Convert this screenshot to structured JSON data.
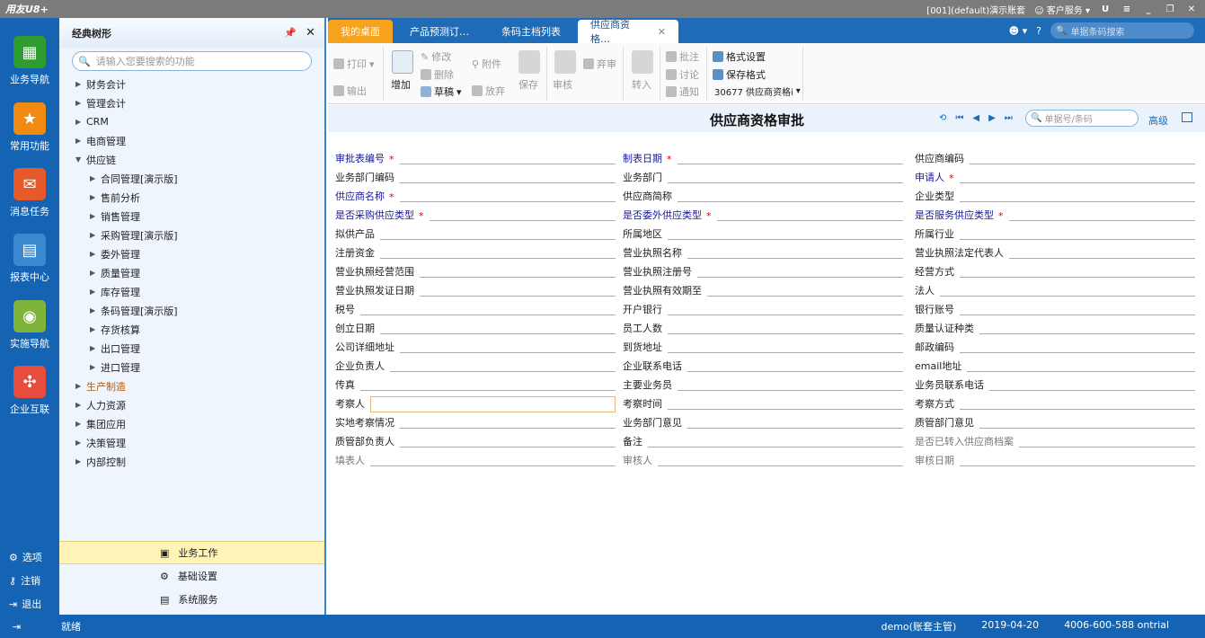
{
  "app": {
    "logo": "用友U8+",
    "account": "[001](default)演示账套",
    "customer_service": "客户服务"
  },
  "leftnav": {
    "items": [
      {
        "label": "业务导航",
        "color": "#2e9c2e"
      },
      {
        "label": "常用功能",
        "color": "#f08a10"
      },
      {
        "label": "消息任务",
        "color": "#e65a2a"
      },
      {
        "label": "报表中心",
        "color": "#3a88cf"
      },
      {
        "label": "实施导航",
        "color": "#7fb43a"
      },
      {
        "label": "企业互联",
        "color": "#e84c3d"
      }
    ],
    "bottom": [
      "选项",
      "注销",
      "退出"
    ]
  },
  "tree": {
    "title": "经典树形",
    "search_placeholder": "请输入您要搜索的功能",
    "items": [
      {
        "label": "财务会计",
        "level": 1,
        "arrow": "▶"
      },
      {
        "label": "管理会计",
        "level": 1,
        "arrow": "▶"
      },
      {
        "label": "CRM",
        "level": 1,
        "arrow": "▶"
      },
      {
        "label": "电商管理",
        "level": 1,
        "arrow": "▶"
      },
      {
        "label": "供应链",
        "level": 1,
        "arrow": "▼"
      },
      {
        "label": "合同管理[演示版]",
        "level": 2,
        "arrow": "▶"
      },
      {
        "label": "售前分析",
        "level": 2,
        "arrow": "▶"
      },
      {
        "label": "销售管理",
        "level": 2,
        "arrow": "▶"
      },
      {
        "label": "采购管理[演示版]",
        "level": 2,
        "arrow": "▶"
      },
      {
        "label": "委外管理",
        "level": 2,
        "arrow": "▶"
      },
      {
        "label": "质量管理",
        "level": 2,
        "arrow": "▶"
      },
      {
        "label": "库存管理",
        "level": 2,
        "arrow": "▶"
      },
      {
        "label": "条码管理[演示版]",
        "level": 2,
        "arrow": "▶"
      },
      {
        "label": "存货核算",
        "level": 2,
        "arrow": "▶"
      },
      {
        "label": "出口管理",
        "level": 2,
        "arrow": "▶"
      },
      {
        "label": "进口管理",
        "level": 2,
        "arrow": "▶"
      },
      {
        "label": "生产制造",
        "level": 1,
        "arrow": "▶",
        "selected": true
      },
      {
        "label": "人力资源",
        "level": 1,
        "arrow": "▶"
      },
      {
        "label": "集团应用",
        "level": 1,
        "arrow": "▶"
      },
      {
        "label": "决策管理",
        "level": 1,
        "arrow": "▶"
      },
      {
        "label": "内部控制",
        "level": 1,
        "arrow": "▶"
      }
    ],
    "bottom": [
      "业务工作",
      "基础设置",
      "系统服务"
    ]
  },
  "tabs": [
    "我的桌面",
    "产品预测订…",
    "条码主档列表",
    "供应商资格…"
  ],
  "header_search_placeholder": "单据条码搜索",
  "toolbar": {
    "print": "打印",
    "output": "输出",
    "add": "增加",
    "modify": "修改",
    "delete": "删除",
    "draft": "草稿",
    "attach": "附件",
    "abandon": "放弃",
    "save": "保存",
    "review": "审核",
    "discard": "弃审",
    "transfer": "转入",
    "annotate": "批注",
    "discuss": "讨论",
    "notify": "通知",
    "format_settings": "格式设置",
    "save_format": "保存格式",
    "template": "30677 供应商资格i"
  },
  "form": {
    "title": "供应商资格审批",
    "search_placeholder": "单据号/条码",
    "advanced": "高级",
    "rows": [
      [
        {
          "label": "审批表编号",
          "req": true
        },
        {
          "label": "制表日期",
          "req": true
        },
        {
          "label": "供应商编码"
        }
      ],
      [
        {
          "label": "业务部门编码"
        },
        {
          "label": "业务部门"
        },
        {
          "label": "申请人",
          "req": true
        }
      ],
      [
        {
          "label": "供应商名称",
          "req": true
        },
        {
          "label": "供应商简称"
        },
        {
          "label": "企业类型"
        }
      ],
      [
        {
          "label": "是否采购供应类型",
          "req": true
        },
        {
          "label": "是否委外供应类型",
          "req": true
        },
        {
          "label": "是否服务供应类型",
          "req": true
        }
      ],
      [
        {
          "label": "拟供产品"
        },
        {
          "label": "所属地区"
        },
        {
          "label": "所属行业"
        }
      ],
      [
        {
          "label": "注册资金"
        },
        {
          "label": "营业执照名称"
        },
        {
          "label": "营业执照法定代表人"
        }
      ],
      [
        {
          "label": "营业执照经营范围"
        },
        {
          "label": "营业执照注册号"
        },
        {
          "label": "经营方式"
        }
      ],
      [
        {
          "label": "营业执照发证日期"
        },
        {
          "label": "营业执照有效期至"
        },
        {
          "label": "法人"
        }
      ],
      [
        {
          "label": "税号"
        },
        {
          "label": "开户银行"
        },
        {
          "label": "银行账号"
        }
      ],
      [
        {
          "label": "创立日期"
        },
        {
          "label": "员工人数"
        },
        {
          "label": "质量认证种类"
        }
      ],
      [
        {
          "label": "公司详细地址"
        },
        {
          "label": "到货地址"
        },
        {
          "label": "邮政编码"
        }
      ],
      [
        {
          "label": "企业负责人"
        },
        {
          "label": "企业联系电话"
        },
        {
          "label": "email地址"
        }
      ],
      [
        {
          "label": "传真"
        },
        {
          "label": "主要业务员"
        },
        {
          "label": "业务员联系电话"
        }
      ],
      [
        {
          "label": "考察人",
          "focused": true
        },
        {
          "label": "考察时间"
        },
        {
          "label": "考察方式"
        }
      ],
      [
        {
          "label": "实地考察情况"
        },
        {
          "label": "业务部门意见"
        },
        {
          "label": "质管部门意见"
        }
      ],
      [
        {
          "label": "质管部负责人"
        },
        {
          "label": "备注"
        },
        {
          "label": "是否已转入供应商档案",
          "gray": true
        }
      ],
      [
        {
          "label": "填表人",
          "gray": true
        },
        {
          "label": "审核人",
          "gray": true
        },
        {
          "label": "审核日期",
          "gray": true
        }
      ]
    ]
  },
  "status": {
    "ready": "就绪",
    "user": "demo(账套主管)",
    "date": "2019-04-20",
    "phone": "4006-600-588 ontrial"
  }
}
